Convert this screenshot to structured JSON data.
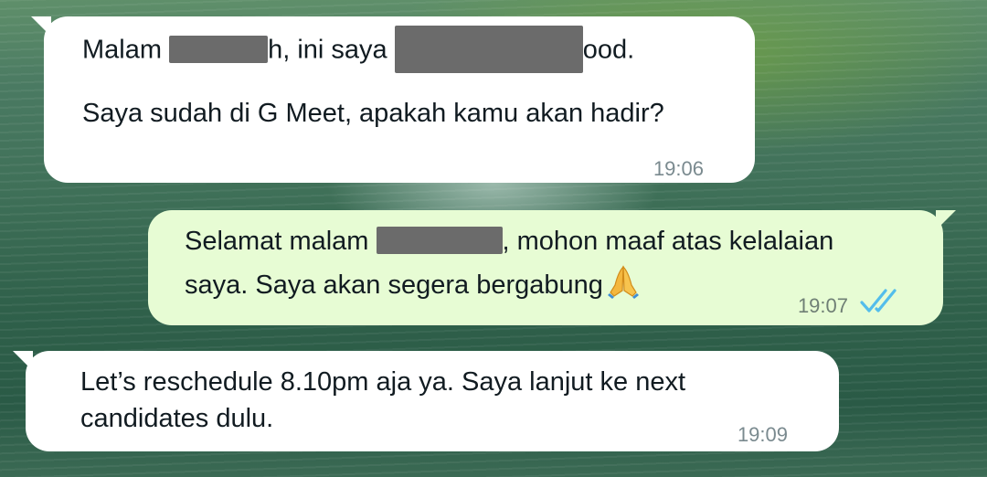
{
  "messages": [
    {
      "direction": "incoming",
      "line1_part1": "Malam ",
      "line1_part2": "h, ini saya ",
      "line1_part3": "ood.",
      "line2": "Saya sudah di G Meet, apakah kamu akan hadir?",
      "time": "19:06"
    },
    {
      "direction": "outgoing",
      "line1_part1": "Selamat malam ",
      "line1_part2": ", mohon maaf atas kelalaian",
      "line2": "saya. Saya akan segera bergabung",
      "emoji": "folded-hands-icon",
      "time": "19:07",
      "status": "read"
    },
    {
      "direction": "incoming",
      "line1": "Let’s reschedule 8.10pm aja ya. Saya lanjut ke next",
      "line2": "candidates dulu.",
      "time": "19:09"
    }
  ],
  "colors": {
    "incoming_bubble": "#ffffff",
    "outgoing_bubble": "#e7fcd4",
    "read_ticks": "#53bdeb",
    "redaction": "#6b6b6b"
  }
}
